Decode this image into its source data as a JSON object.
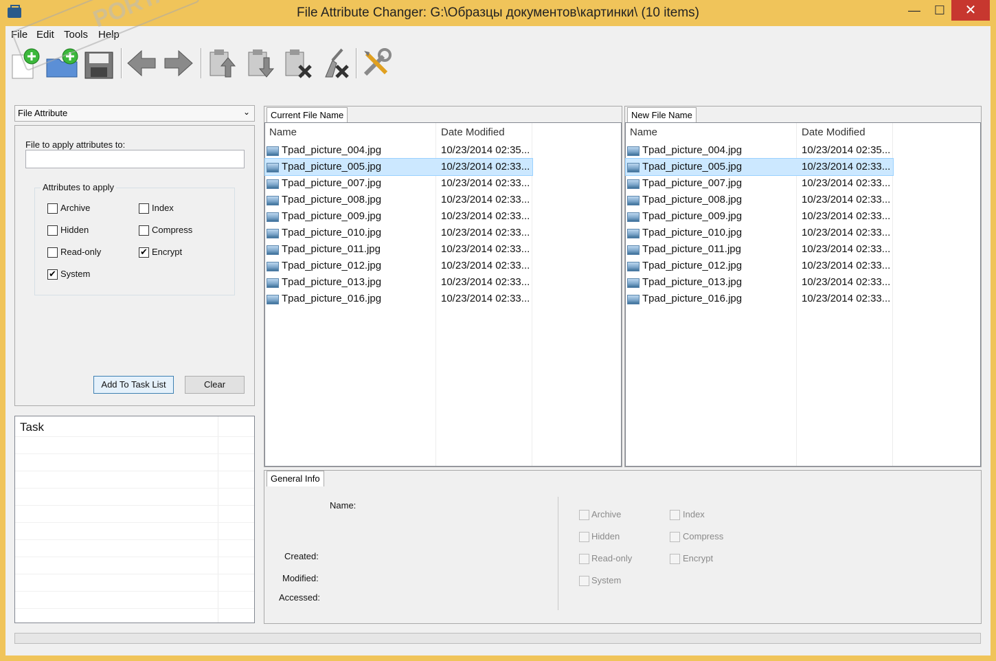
{
  "window": {
    "title": "File Attribute Changer: G:\\Образцы документов\\картинки\\ (10 items)",
    "min_glyph": "—",
    "max_glyph": "☐",
    "close_glyph": "✕"
  },
  "menu": [
    "File",
    "Edit",
    "Tools",
    "Help"
  ],
  "toolbar": {
    "icons": [
      "add-file-icon",
      "add-folder-icon",
      "save-icon",
      "back-arrow-icon",
      "forward-arrow-icon",
      "paste-up-icon",
      "paste-down-icon",
      "delete-icon",
      "clear-broom-icon",
      "tools-icon"
    ]
  },
  "left": {
    "mode_select": "File Attribute",
    "file_label": "File to apply attributes to:",
    "file_value": "",
    "group_label": "Attributes to apply",
    "attributes": [
      {
        "label": "Archive",
        "checked": false
      },
      {
        "label": "Index",
        "checked": false
      },
      {
        "label": "Hidden",
        "checked": false
      },
      {
        "label": "Compress",
        "checked": false
      },
      {
        "label": "Read-only",
        "checked": false
      },
      {
        "label": "Encrypt",
        "checked": true
      },
      {
        "label": "System",
        "checked": true
      }
    ],
    "add_button": "Add To Task List",
    "clear_button": "Clear",
    "task_header": "Task"
  },
  "current": {
    "tab": "Current File Name",
    "col_name": "Name",
    "col_date": "Date Modified"
  },
  "newnames": {
    "tab": "New File Name",
    "col_name": "Name",
    "col_date": "Date Modified"
  },
  "files": [
    {
      "name": "Tpad_picture_004.jpg",
      "date": "10/23/2014 02:35..."
    },
    {
      "name": "Tpad_picture_005.jpg",
      "date": "10/23/2014 02:33..."
    },
    {
      "name": "Tpad_picture_007.jpg",
      "date": "10/23/2014 02:33..."
    },
    {
      "name": "Tpad_picture_008.jpg",
      "date": "10/23/2014 02:33..."
    },
    {
      "name": "Tpad_picture_009.jpg",
      "date": "10/23/2014 02:33..."
    },
    {
      "name": "Tpad_picture_010.jpg",
      "date": "10/23/2014 02:33..."
    },
    {
      "name": "Tpad_picture_011.jpg",
      "date": "10/23/2014 02:33..."
    },
    {
      "name": "Tpad_picture_012.jpg",
      "date": "10/23/2014 02:33..."
    },
    {
      "name": "Tpad_picture_013.jpg",
      "date": "10/23/2014 02:33..."
    },
    {
      "name": "Tpad_picture_016.jpg",
      "date": "10/23/2014 02:33..."
    }
  ],
  "selected_index": 1,
  "info": {
    "tab": "General Info",
    "name_label": "Name:",
    "created_label": "Created:",
    "modified_label": "Modified:",
    "accessed_label": "Accessed:",
    "attributes": [
      "Archive",
      "Index",
      "Hidden",
      "Compress",
      "Read-only",
      "Encrypt",
      "System"
    ]
  },
  "watermark": "PORTAL"
}
